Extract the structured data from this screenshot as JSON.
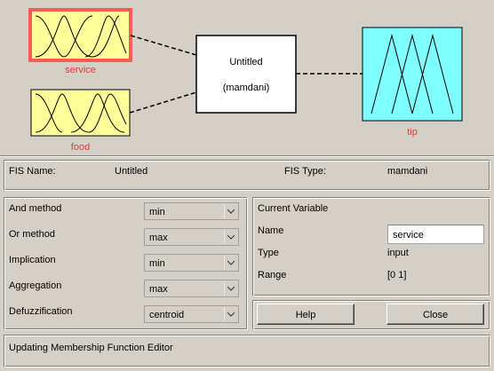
{
  "diagram": {
    "inputs": [
      {
        "name": "service",
        "selected": true
      },
      {
        "name": "food",
        "selected": false
      }
    ],
    "system": {
      "name": "Untitled",
      "type": "(mamdani)"
    },
    "outputs": [
      {
        "name": "tip"
      }
    ],
    "colors": {
      "input_fill": "#ffff99",
      "output_fill": "#80ffff",
      "selected_border": "#ff5a5a",
      "label_red": "#e03c3c"
    }
  },
  "fis": {
    "name_label": "FIS Name:",
    "name_value": "Untitled",
    "type_label": "FIS Type:",
    "type_value": "mamdani"
  },
  "methods": [
    {
      "label": "And method",
      "value": "min"
    },
    {
      "label": "Or method",
      "value": "max"
    },
    {
      "label": "Implication",
      "value": "min"
    },
    {
      "label": "Aggregation",
      "value": "max"
    },
    {
      "label": "Defuzzification",
      "value": "centroid"
    }
  ],
  "current_variable": {
    "title": "Current Variable",
    "name_label": "Name",
    "name_value": "service",
    "type_label": "Type",
    "type_value": "input",
    "range_label": "Range",
    "range_value": "[0 1]"
  },
  "buttons": {
    "help": "Help",
    "close": "Close"
  },
  "status": {
    "text": "Updating Membership Function Editor"
  }
}
